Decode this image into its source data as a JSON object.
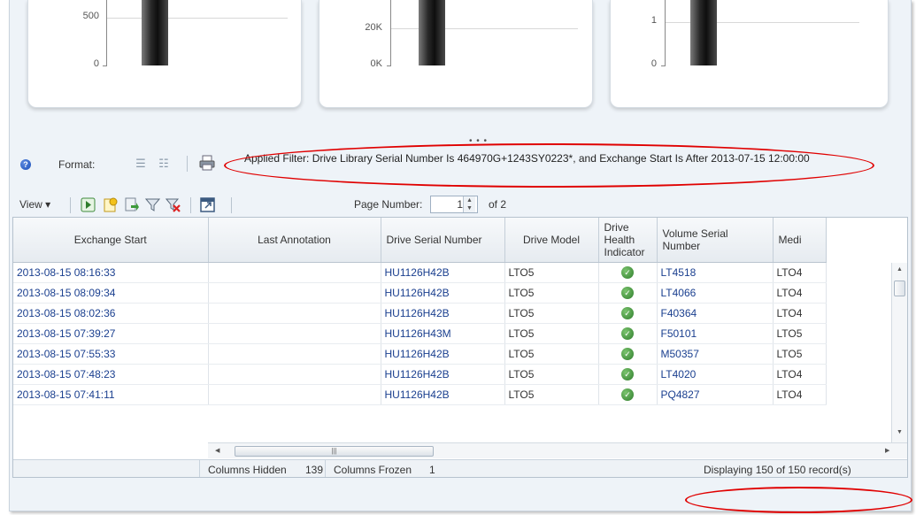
{
  "charts": [
    {
      "ticks": [
        "500",
        "0"
      ]
    },
    {
      "ticks": [
        "20K",
        "0K"
      ]
    },
    {
      "ticks": [
        "1",
        "0"
      ]
    }
  ],
  "format_bar": {
    "format_label": "Format:",
    "applied_filter": "Applied Filter: Drive Library Serial Number Is 464970G+1243SY0223*, and Exchange Start Is After 2013-07-15 12:00:00"
  },
  "toolbar": {
    "view_label": "View ▾",
    "page_number_label": "Page Number:",
    "page_number_value": "1",
    "page_of": "of 2"
  },
  "table": {
    "columns": [
      "Exchange Start",
      "Last Annotation",
      "Drive Serial Number",
      "Drive Model",
      "Drive Health Indicator",
      "Volume Serial Number",
      "Medi"
    ],
    "rows": [
      {
        "exchange_start": "2013-08-15 08:16:33",
        "last_annotation": "",
        "drive_serial": "HU1126H42B",
        "drive_model": "LTO5",
        "volume_serial": "LT4518",
        "media": "LTO4"
      },
      {
        "exchange_start": "2013-08-15 08:09:34",
        "last_annotation": "",
        "drive_serial": "HU1126H42B",
        "drive_model": "LTO5",
        "volume_serial": "LT4066",
        "media": "LTO4"
      },
      {
        "exchange_start": "2013-08-15 08:02:36",
        "last_annotation": "",
        "drive_serial": "HU1126H42B",
        "drive_model": "LTO5",
        "volume_serial": "F40364",
        "media": "LTO4"
      },
      {
        "exchange_start": "2013-08-15 07:39:27",
        "last_annotation": "",
        "drive_serial": "HU1126H43M",
        "drive_model": "LTO5",
        "volume_serial": "F50101",
        "media": "LTO5"
      },
      {
        "exchange_start": "2013-08-15 07:55:33",
        "last_annotation": "",
        "drive_serial": "HU1126H42B",
        "drive_model": "LTO5",
        "volume_serial": "M50357",
        "media": "LTO5"
      },
      {
        "exchange_start": "2013-08-15 07:48:23",
        "last_annotation": "",
        "drive_serial": "HU1126H42B",
        "drive_model": "LTO5",
        "volume_serial": "LT4020",
        "media": "LTO4"
      },
      {
        "exchange_start": "2013-08-15 07:41:11",
        "last_annotation": "",
        "drive_serial": "HU1126H42B",
        "drive_model": "LTO5",
        "volume_serial": "PQ4827",
        "media": "LTO4"
      }
    ],
    "health_icon": "check-circle-icon"
  },
  "status_bar": {
    "columns_hidden_label": "Columns Hidden",
    "columns_hidden_value": "139",
    "columns_frozen_label": "Columns Frozen",
    "columns_frozen_value": "1",
    "displaying": "Displaying 150 of 150 record(s)"
  },
  "colors": {
    "link": "#1a3f8f",
    "annotation_red": "#e00000",
    "health_ok": "#2f7d2c"
  }
}
